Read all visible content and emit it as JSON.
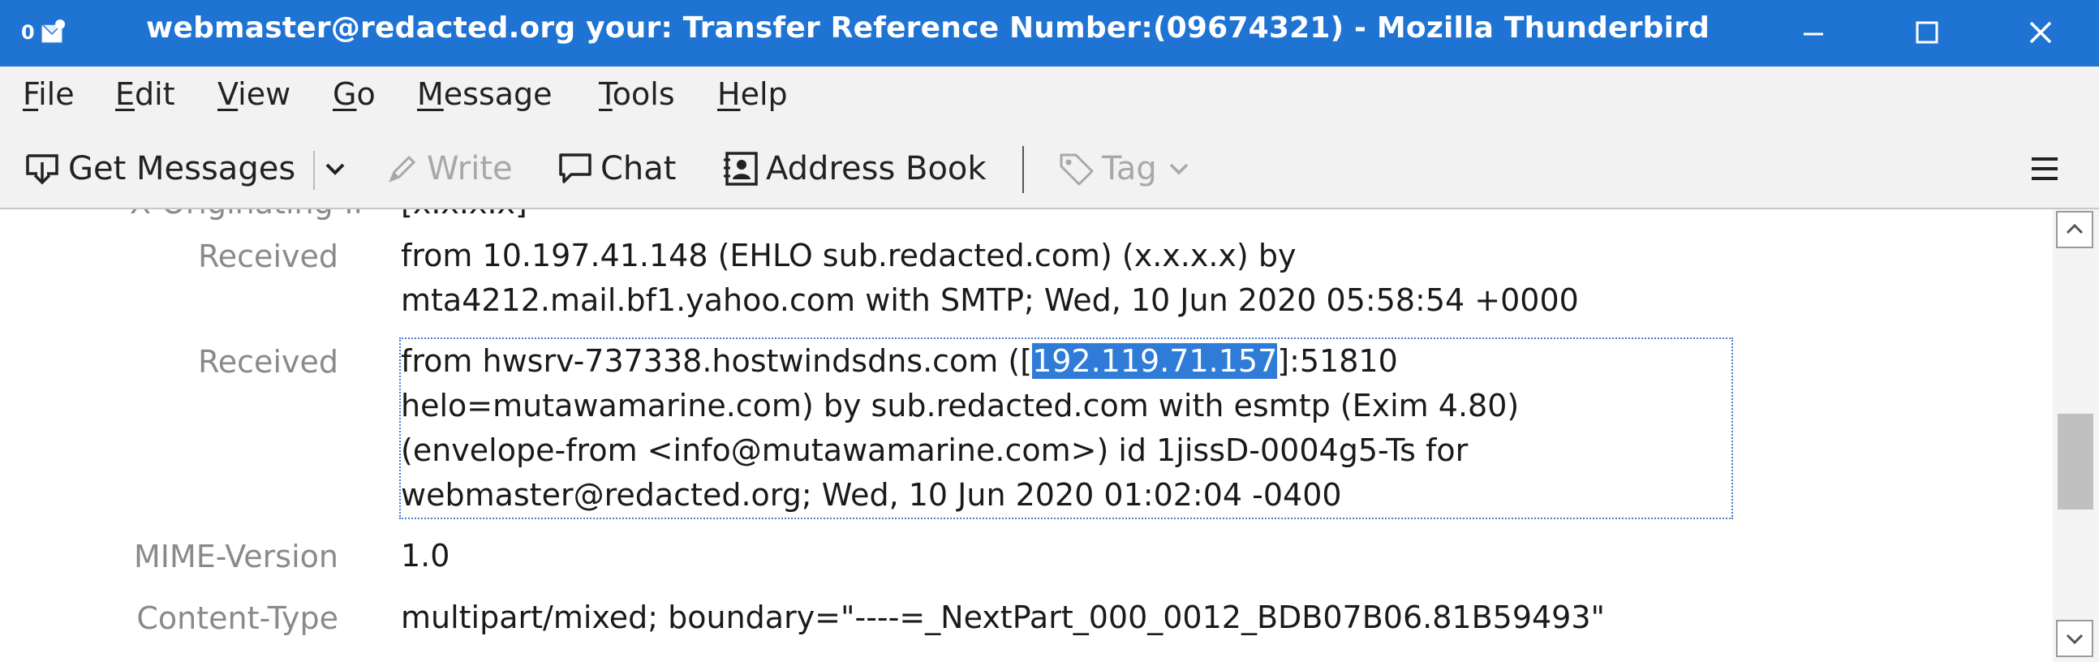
{
  "window": {
    "title": "webmaster@redacted.org your: Transfer Reference Number:(09674321) - Mozilla Thunderbird",
    "unread_count": "0",
    "app_icon": "thunderbird-mail-icon",
    "controls": {
      "minimize_icon": "minimize-icon",
      "maximize_icon": "maximize-icon",
      "close_icon": "close-icon"
    },
    "accent_color": "#1f74d3"
  },
  "menubar": {
    "items": [
      {
        "label": "File",
        "mnemonic": "F",
        "rest": "ile"
      },
      {
        "label": "Edit",
        "mnemonic": "E",
        "rest": "dit"
      },
      {
        "label": "View",
        "mnemonic": "V",
        "rest": "iew"
      },
      {
        "label": "Go",
        "mnemonic": "G",
        "rest": "o"
      },
      {
        "label": "Message",
        "mnemonic": "M",
        "rest": "essage"
      },
      {
        "label": "Tools",
        "mnemonic": "T",
        "rest": "ools"
      },
      {
        "label": "Help",
        "mnemonic": "H",
        "rest": "elp"
      }
    ]
  },
  "toolbar": {
    "get_messages": "Get Messages",
    "write": "Write",
    "chat": "Chat",
    "address_book": "Address Book",
    "tag": "Tag"
  },
  "headers": {
    "cut_label": "X-Originating-IP",
    "cut_value": "[x.x.x.x]",
    "received_1": {
      "label": "Received",
      "line1": "from 10.197.41.148 (EHLO sub.redacted.com) (x.x.x.x) by",
      "line2": "mta4212.mail.bf1.yahoo.com with SMTP; Wed, 10 Jun 2020 05:58:54 +0000"
    },
    "received_2": {
      "label": "Received",
      "line1_prefix": "from hwsrv-737338.hostwindsdns.com ([",
      "line1_ip": "192.119.71.157",
      "line1_suffix": "]:51810",
      "line2": "helo=mutawamarine.com) by sub.redacted.com with esmtp (Exim 4.80)",
      "line3": "(envelope-from <info@mutawamarine.com>) id 1jissD-0004g5-Ts for",
      "line4": "webmaster@redacted.org; Wed, 10 Jun 2020 01:02:04 -0400"
    },
    "mime_version": {
      "label": "MIME-Version",
      "value": "1.0"
    },
    "content_type": {
      "label": "Content-Type",
      "value": "multipart/mixed; boundary=\"----=_NextPart_000_0012_BDB07B06.81B59493\""
    }
  }
}
